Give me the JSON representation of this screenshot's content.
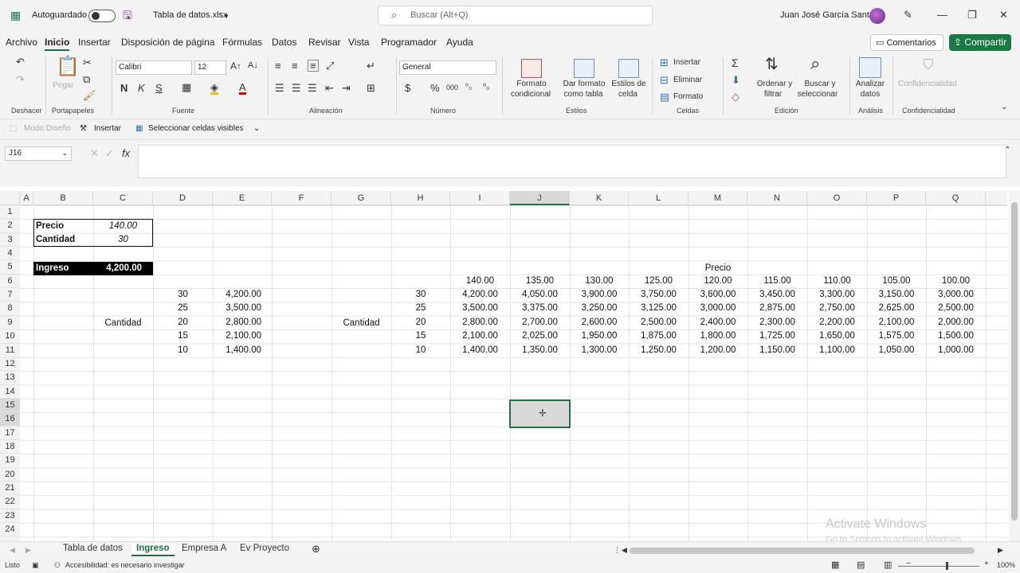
{
  "titlebar": {
    "autosave_label": "Autoguardado",
    "filename": "Tabla de datos.xlsx",
    "search_placeholder": "Buscar (Alt+Q)",
    "user_name": "Juan José García Santos"
  },
  "menu": {
    "items": [
      "Archivo",
      "Inicio",
      "Insertar",
      "Disposición de página",
      "Fórmulas",
      "Datos",
      "Revisar",
      "Vista",
      "Programador",
      "Ayuda"
    ],
    "comments": "Comentarios",
    "share": "Compartir"
  },
  "ribbon": {
    "groups": [
      "Deshacer",
      "Portapapeles",
      "Fuente",
      "Alineación",
      "Número",
      "Estilos",
      "Celdas",
      "Edición",
      "Análisis",
      "Confidencialidad"
    ],
    "paste": "Pegar",
    "font_name": "Calibri",
    "font_size": "12",
    "number_format": "General",
    "cond_format": [
      "Formato",
      "condicional"
    ],
    "format_table": [
      "Dar formato",
      "como tabla"
    ],
    "cell_styles": [
      "Estilos de",
      "celda"
    ],
    "insert": "Insertar",
    "delete": "Eliminar",
    "format": "Formato",
    "sort": [
      "Ordenar y",
      "filtrar"
    ],
    "find": [
      "Buscar y",
      "seleccionar"
    ],
    "analyze": [
      "Analizar",
      "datos"
    ],
    "confidential": "Confidencialidad"
  },
  "qat": {
    "design_mode": "Modo Diseño",
    "insert": "Insertar",
    "select_visible": "Seleccionar celdas visibles"
  },
  "formula_bar": {
    "name_box": "J16",
    "fx": "fx"
  },
  "grid": {
    "columns": [
      "A",
      "B",
      "C",
      "D",
      "E",
      "F",
      "G",
      "H",
      "I",
      "J",
      "K",
      "L",
      "M",
      "N",
      "O",
      "P",
      "Q"
    ],
    "selected_column": "J",
    "rows": [
      "1",
      "2",
      "3",
      "4",
      "5",
      "6",
      "7",
      "8",
      "9",
      "10",
      "11",
      "12",
      "13",
      "14",
      "15",
      "16",
      "17",
      "18",
      "19",
      "20",
      "21",
      "22",
      "23",
      "24"
    ],
    "selected_rows": [
      "15",
      "16"
    ],
    "price_label": "Precio",
    "price_value": "140.00",
    "qty_label": "Cantidad",
    "qty_value": "30",
    "revenue_label": "Ingreso",
    "revenue_value": "4,200.00",
    "one_way": {
      "label": "Cantidad",
      "quantities": [
        "30",
        "25",
        "20",
        "15",
        "10"
      ],
      "results": [
        "4,200.00",
        "3,500.00",
        "2,800.00",
        "2,100.00",
        "1,400.00"
      ]
    },
    "two_way": {
      "row_label": "Cantidad",
      "col_label": "Precio",
      "prices": [
        "140.00",
        "135.00",
        "130.00",
        "125.00",
        "120.00",
        "115.00",
        "110.00",
        "105.00",
        "100.00"
      ],
      "quantities": [
        "30",
        "25",
        "20",
        "15",
        "10"
      ],
      "matrix": [
        [
          "4,200.00",
          "4,050.00",
          "3,900.00",
          "3,750.00",
          "3,600.00",
          "3,450.00",
          "3,300.00",
          "3,150.00",
          "3,000.00"
        ],
        [
          "3,500.00",
          "3,375.00",
          "3,250.00",
          "3,125.00",
          "3,000.00",
          "2,875.00",
          "2,750.00",
          "2,625.00",
          "2,500.00"
        ],
        [
          "2,800.00",
          "2,700.00",
          "2,600.00",
          "2,500.00",
          "2,400.00",
          "2,300.00",
          "2,200.00",
          "2,100.00",
          "2,000.00"
        ],
        [
          "2,100.00",
          "2,025.00",
          "1,950.00",
          "1,875.00",
          "1,800.00",
          "1,725.00",
          "1,650.00",
          "1,575.00",
          "1,500.00"
        ],
        [
          "1,400.00",
          "1,350.00",
          "1,300.00",
          "1,250.00",
          "1,200.00",
          "1,150.00",
          "1,100.00",
          "1,050.00",
          "1,000.00"
        ]
      ]
    },
    "watermark_title": "Activate Windows",
    "watermark_sub": "Go to Settings to activate Windows."
  },
  "sheets": {
    "tabs": [
      "Tabla de datos",
      "Ingreso",
      "Empresa A",
      "Ev Proyecto"
    ],
    "active": "Ingreso"
  },
  "status": {
    "ready": "Listo",
    "accessibility": "Accesibilidad: es necesario investigar",
    "zoom": "100%"
  }
}
